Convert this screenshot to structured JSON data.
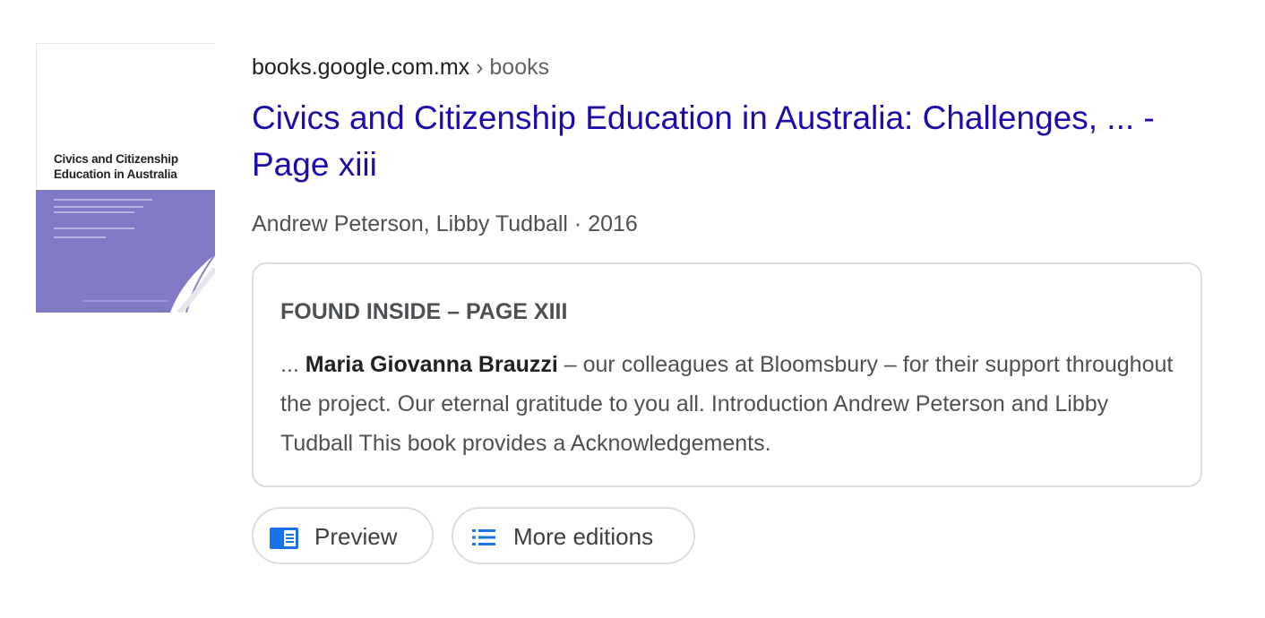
{
  "book": {
    "cover": {
      "title_line1": "Civics and Citizenship",
      "title_line2": "Education in Australia",
      "band_color": "#7f7ac3"
    },
    "cite": {
      "domain": "books.google.com.mx",
      "separator": " › ",
      "path": "books"
    },
    "title": "Civics and Citizenship Education in Australia: Challenges, ... - Page xiii",
    "meta": "Andrew Peterson, Libby Tudball · 2016",
    "found_inside": {
      "heading": "FOUND INSIDE – PAGE XIII",
      "snippet_prefix": "... ",
      "snippet_bold": "Maria Giovanna Brauzzi",
      "snippet_rest": " – our colleagues at Bloomsbury – for their support throughout the project. Our eternal gratitude to you all. Introduction Andrew Peterson and Libby Tudball This book provides a Acknowledgements."
    },
    "actions": {
      "preview_label": "Preview",
      "preview_icon": "book-preview-icon",
      "editions_label": "More editions",
      "editions_icon": "list-icon"
    }
  },
  "colors": {
    "link": "#1a0dab",
    "text": "#4d5156",
    "accent_icon": "#1a73e8",
    "border": "#dadce0"
  }
}
